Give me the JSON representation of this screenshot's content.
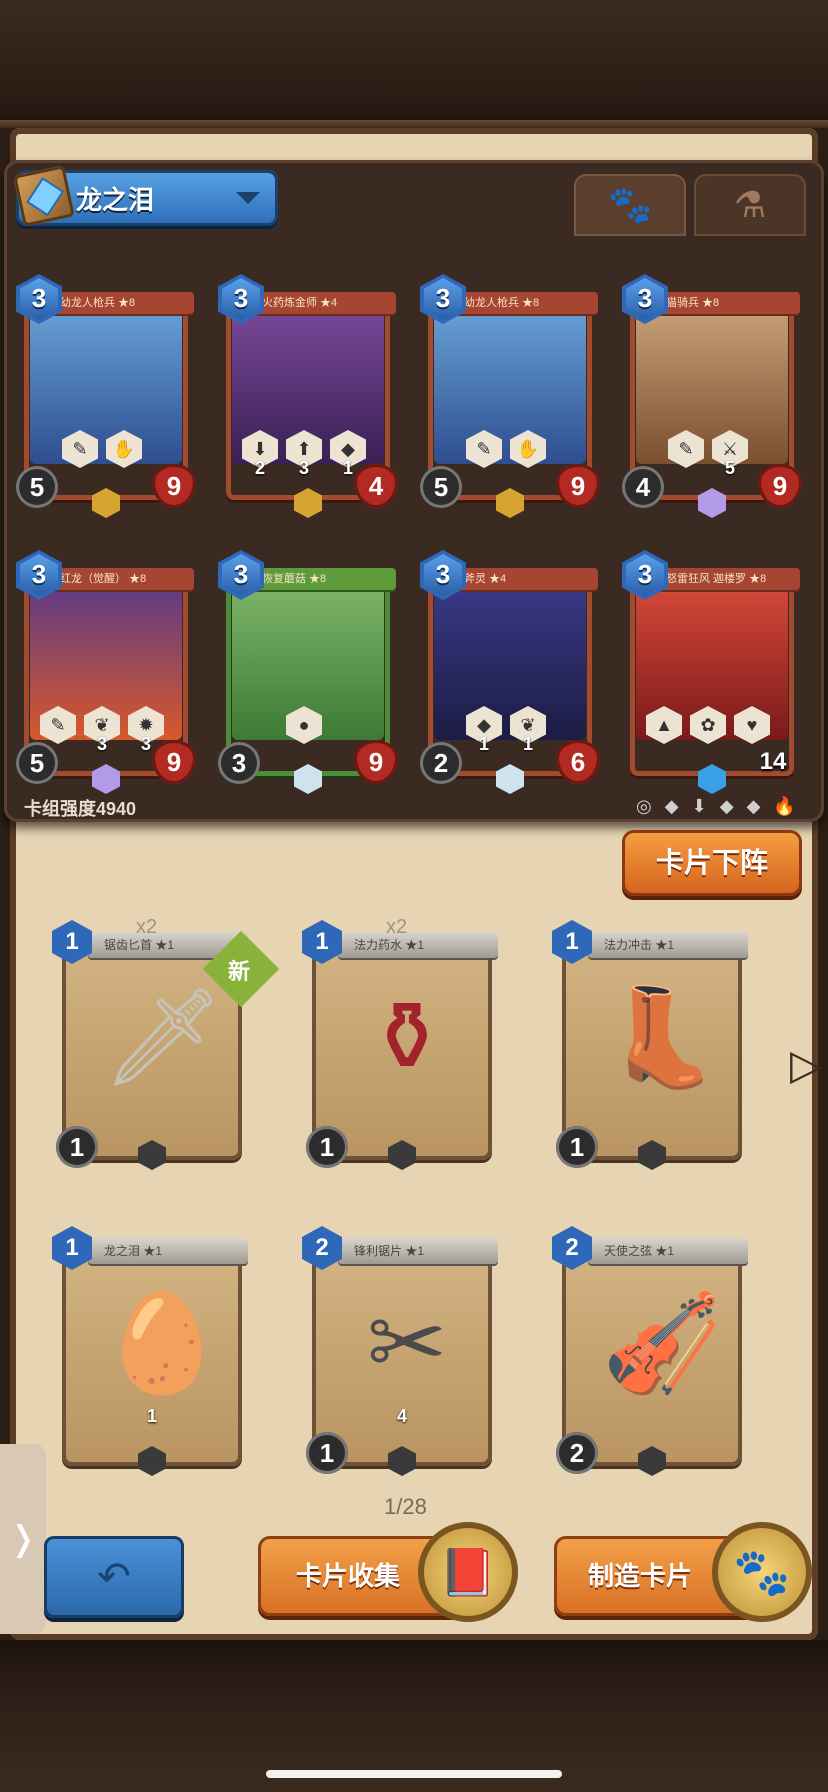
{
  "deck": {
    "name": "龙之泪",
    "strength": "卡组强度4940"
  },
  "tabs": [
    {
      "icon": "paw-icon",
      "glyph": "🐾"
    },
    {
      "icon": "potion-icon",
      "glyph": "⚗"
    }
  ],
  "deck_cards": [
    {
      "name": "幼龙人枪兵 ★8",
      "cost": "3",
      "atk": "5",
      "hp": "9",
      "abilities": [
        {
          "g": "✎",
          "n": ""
        },
        {
          "g": "✋",
          "n": ""
        }
      ],
      "rarity_color": "#d6a531",
      "color": "red",
      "art": "linear-gradient(#6aa3d8,#2e4e8f)"
    },
    {
      "name": "火药炼金师 ★4",
      "cost": "3",
      "atk": "",
      "hp": "4",
      "abilities": [
        {
          "g": "⬇",
          "n": "2"
        },
        {
          "g": "⬆",
          "n": "3"
        },
        {
          "g": "◆",
          "n": "1"
        }
      ],
      "rarity_color": "#d6a531",
      "color": "red",
      "art": "linear-gradient(#7a4a9a,#3a1f55)"
    },
    {
      "name": "幼龙人枪兵 ★8",
      "cost": "3",
      "atk": "5",
      "hp": "9",
      "abilities": [
        {
          "g": "✎",
          "n": ""
        },
        {
          "g": "✋",
          "n": ""
        }
      ],
      "rarity_color": "#d6a531",
      "color": "red",
      "art": "linear-gradient(#6aa3d8,#2e4e8f)"
    },
    {
      "name": "猫骑兵 ★8",
      "cost": "3",
      "atk": "4",
      "hp": "9",
      "abilities": [
        {
          "g": "✎",
          "n": ""
        },
        {
          "g": "⚔",
          "n": "5"
        }
      ],
      "rarity_color": "#b39ae8",
      "color": "red",
      "art": "linear-gradient(#c9a27a,#7a4f30)"
    },
    {
      "name": "红龙（觉醒） ★8",
      "cost": "3",
      "atk": "5",
      "hp": "9",
      "abilities": [
        {
          "g": "✎",
          "n": ""
        },
        {
          "g": "❦",
          "n": "3"
        },
        {
          "g": "✹",
          "n": "3"
        }
      ],
      "rarity_color": "#b39ae8",
      "color": "red",
      "art": "linear-gradient(#5a3a8a,#d8582a)"
    },
    {
      "name": "恢复蘑菇 ★8",
      "cost": "3",
      "atk": "3",
      "hp": "9",
      "abilities": [
        {
          "g": "●",
          "n": ""
        }
      ],
      "rarity_color": "#cfe3ee",
      "color": "green",
      "art": "linear-gradient(#7fb66a,#3e7a36)"
    },
    {
      "name": "斧灵 ★4",
      "cost": "3",
      "atk": "2",
      "hp": "6",
      "abilities": [
        {
          "g": "◆",
          "n": "1"
        },
        {
          "g": "❦",
          "n": "1"
        }
      ],
      "rarity_color": "#cfe3ee",
      "color": "red",
      "art": "linear-gradient(#3a3a8a,#1c1c44)"
    },
    {
      "name": "怒雷狂风 迦楼罗 ★8",
      "cost": "3",
      "atk": "",
      "hp": "14",
      "abilities": [
        {
          "g": "▲",
          "n": ""
        },
        {
          "g": "✿",
          "n": ""
        },
        {
          "g": "♥",
          "n": ""
        }
      ],
      "rarity_color": "#3aa0e8",
      "color": "red",
      "art": "linear-gradient(#d84a3a,#7a1a1a)"
    }
  ],
  "filter_icons": [
    "◎",
    "◆",
    "⬇",
    "◆",
    "◆",
    "🔥"
  ],
  "remove_button": "卡片下阵",
  "collection": [
    {
      "name": "锯齿匕首 ★1",
      "cost": "1",
      "atk": "1",
      "qty": "x2",
      "item_icon": "dagger-icon",
      "item": "🗡",
      "item_color": "#c7c2b8",
      "is_new": true,
      "new_label": "新",
      "abil_num": ""
    },
    {
      "name": "法力药水 ★1",
      "cost": "1",
      "atk": "1",
      "qty": "x2",
      "item_icon": "potion-icon",
      "item": "⚱",
      "item_color": "#a2232c",
      "is_new": false,
      "abil_num": ""
    },
    {
      "name": "法力冲击 ★1",
      "cost": "1",
      "atk": "1",
      "qty": "",
      "item_icon": "boot-icon",
      "item": "👢",
      "item_color": "#3f7bc6",
      "is_new": false,
      "abil_num": ""
    },
    {
      "name": "龙之泪 ★1",
      "cost": "1",
      "atk": "",
      "qty": "",
      "item_icon": "egg-icon",
      "item": "🥚",
      "item_color": "#1f6a6a",
      "is_new": false,
      "abil_num": "1"
    },
    {
      "name": "锋利锯片 ★1",
      "cost": "2",
      "atk": "1",
      "qty": "",
      "item_icon": "blades-icon",
      "item": "✂",
      "item_color": "#4b4b4b",
      "is_new": false,
      "abil_num": "4"
    },
    {
      "name": "天使之弦 ★1",
      "cost": "2",
      "atk": "2",
      "qty": "",
      "item_icon": "lute-icon",
      "item": "🎻",
      "item_color": "#8a5a30",
      "is_new": false,
      "abil_num": ""
    }
  ],
  "page": "1/28",
  "side_tab": "❭",
  "back_button": "↶",
  "collect_button": "卡片收集",
  "craft_button": "制造卡片",
  "collect_icon": "📕",
  "craft_icon": "🐾"
}
